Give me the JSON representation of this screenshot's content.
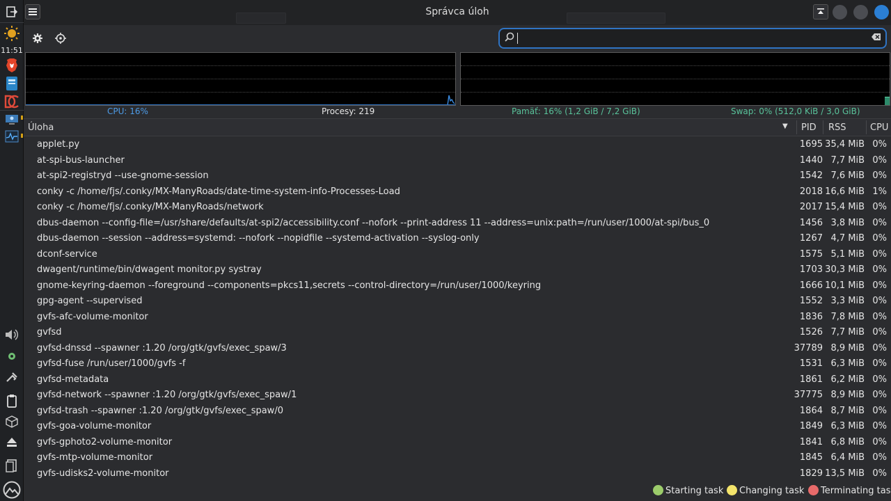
{
  "dock": {
    "clock": "11:51"
  },
  "window": {
    "title": "Správca úloh"
  },
  "search": {
    "value": ""
  },
  "stats": {
    "cpu": "CPU: 16%",
    "processes": "Procesy: 219",
    "memory": "Pamäť: 16% (1,2 GiB / 7,2 GiB)",
    "swap": "Swap: 0% (512,0 KiB / 3,0 GiB)"
  },
  "columns": {
    "task": "Úloha",
    "pid": "PID",
    "rss": "RSS",
    "cpu": "CPU"
  },
  "rows": [
    {
      "cmd": "applet.py",
      "pid": "1695",
      "rss": "35,4 MiB",
      "cpu": "0%"
    },
    {
      "cmd": "at-spi-bus-launcher",
      "pid": "1440",
      "rss": "7,7 MiB",
      "cpu": "0%"
    },
    {
      "cmd": "at-spi2-registryd --use-gnome-session",
      "pid": "1542",
      "rss": "7,6 MiB",
      "cpu": "0%"
    },
    {
      "cmd": "conky -c /home/fjs/.conky/MX-ManyRoads/date-time-system-info-Processes-Load",
      "pid": "2018",
      "rss": "16,6 MiB",
      "cpu": "1%"
    },
    {
      "cmd": "conky -c /home/fjs/.conky/MX-ManyRoads/network",
      "pid": "2017",
      "rss": "15,4 MiB",
      "cpu": "0%"
    },
    {
      "cmd": "dbus-daemon --config-file=/usr/share/defaults/at-spi2/accessibility.conf --nofork --print-address 11 --address=unix:path=/run/user/1000/at-spi/bus_0",
      "pid": "1456",
      "rss": "3,8 MiB",
      "cpu": "0%"
    },
    {
      "cmd": "dbus-daemon --session --address=systemd: --nofork --nopidfile --systemd-activation --syslog-only",
      "pid": "1267",
      "rss": "4,7 MiB",
      "cpu": "0%"
    },
    {
      "cmd": "dconf-service",
      "pid": "1575",
      "rss": "5,1 MiB",
      "cpu": "0%"
    },
    {
      "cmd": "dwagent/runtime/bin/dwagent monitor.py systray",
      "pid": "1703",
      "rss": "30,3 MiB",
      "cpu": "0%"
    },
    {
      "cmd": "gnome-keyring-daemon --foreground --components=pkcs11,secrets --control-directory=/run/user/1000/keyring",
      "pid": "1666",
      "rss": "10,1 MiB",
      "cpu": "0%"
    },
    {
      "cmd": "gpg-agent --supervised",
      "pid": "1552",
      "rss": "3,3 MiB",
      "cpu": "0%"
    },
    {
      "cmd": "gvfs-afc-volume-monitor",
      "pid": "1836",
      "rss": "7,8 MiB",
      "cpu": "0%"
    },
    {
      "cmd": "gvfsd",
      "pid": "1526",
      "rss": "7,7 MiB",
      "cpu": "0%"
    },
    {
      "cmd": "gvfsd-dnssd --spawner :1.20 /org/gtk/gvfs/exec_spaw/3",
      "pid": "37789",
      "rss": "8,9 MiB",
      "cpu": "0%"
    },
    {
      "cmd": "gvfsd-fuse /run/user/1000/gvfs -f",
      "pid": "1531",
      "rss": "6,3 MiB",
      "cpu": "0%"
    },
    {
      "cmd": "gvfsd-metadata",
      "pid": "1861",
      "rss": "6,2 MiB",
      "cpu": "0%"
    },
    {
      "cmd": "gvfsd-network --spawner :1.20 /org/gtk/gvfs/exec_spaw/1",
      "pid": "37775",
      "rss": "8,9 MiB",
      "cpu": "0%"
    },
    {
      "cmd": "gvfsd-trash --spawner :1.20 /org/gtk/gvfs/exec_spaw/0",
      "pid": "1864",
      "rss": "8,7 MiB",
      "cpu": "0%"
    },
    {
      "cmd": "gvfs-goa-volume-monitor",
      "pid": "1849",
      "rss": "6,3 MiB",
      "cpu": "0%"
    },
    {
      "cmd": "gvfs-gphoto2-volume-monitor",
      "pid": "1841",
      "rss": "6,8 MiB",
      "cpu": "0%"
    },
    {
      "cmd": "gvfs-mtp-volume-monitor",
      "pid": "1845",
      "rss": "6,4 MiB",
      "cpu": "0%"
    },
    {
      "cmd": "gvfs-udisks2-volume-monitor",
      "pid": "1829",
      "rss": "13,5 MiB",
      "cpu": "0%"
    }
  ],
  "legend": {
    "starting": "Starting task",
    "changing": "Changing task",
    "terminating": "Terminating task"
  },
  "colors": {
    "cpu_text": "#4d9be6",
    "memory_text": "#59c29a",
    "swap_text": "#59c29a",
    "starting": "#9ccc6b",
    "changing": "#f3e46b",
    "terminating": "#e86a6a",
    "accent": "#2f74c4"
  }
}
